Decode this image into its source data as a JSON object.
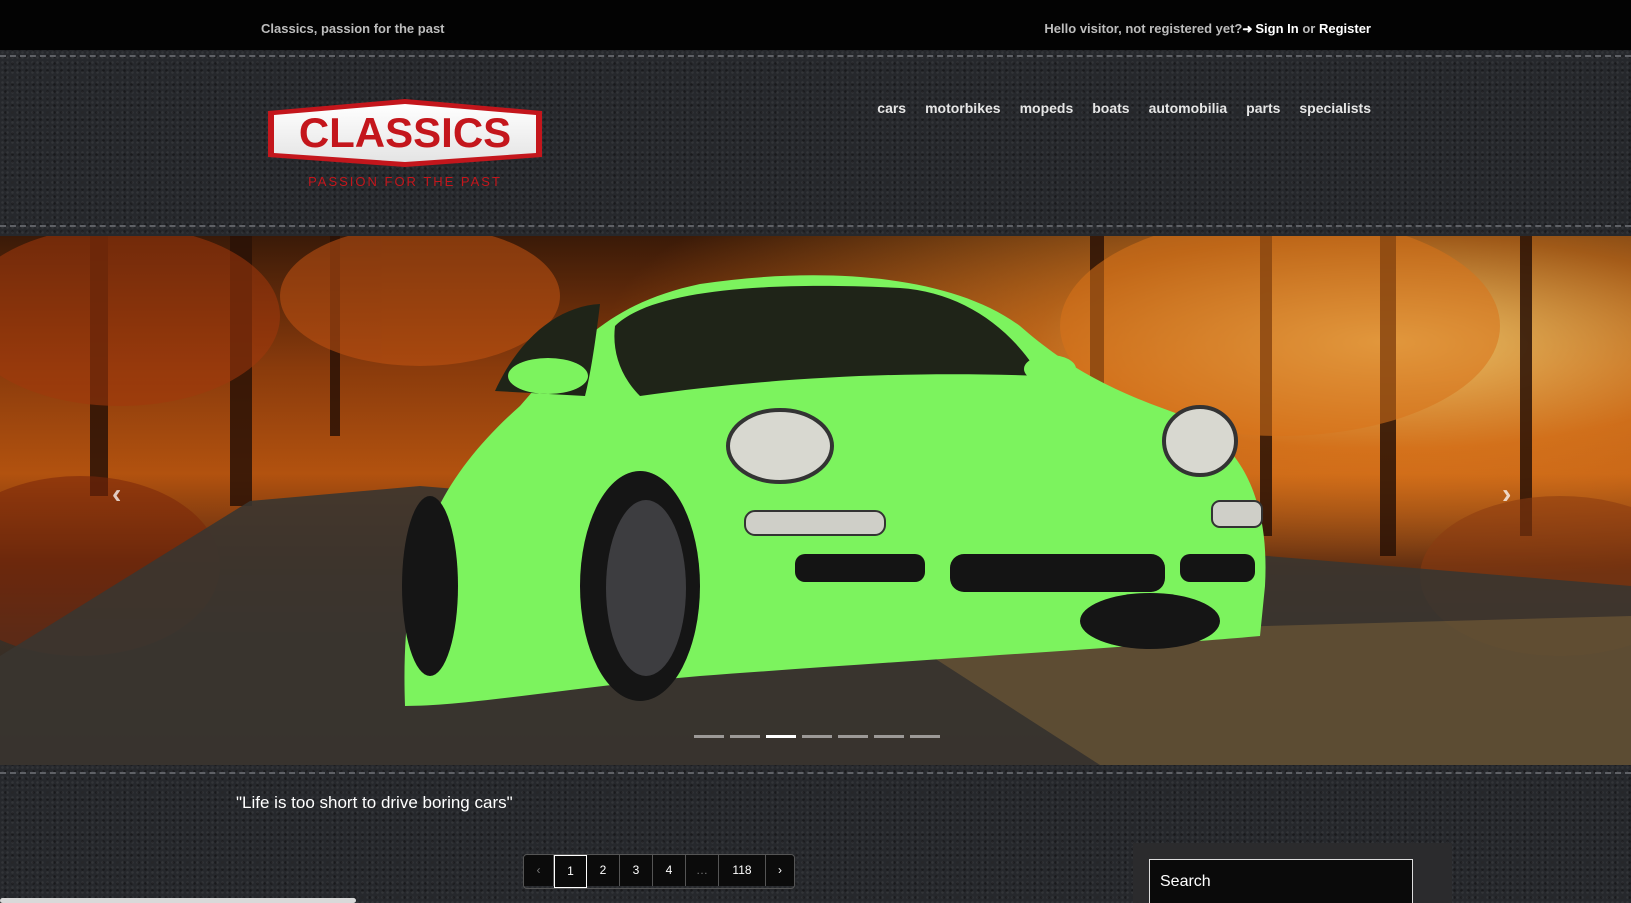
{
  "topbar": {
    "tagline": "Classics, passion for the past",
    "greeting": "Hello visitor, not registered yet?",
    "signin_label": "Sign In",
    "or_text": "or",
    "register_label": "Register"
  },
  "logo": {
    "title": "CLASSICS",
    "subtitle": "PASSION FOR THE PAST"
  },
  "nav": {
    "items": [
      {
        "label": "cars"
      },
      {
        "label": "motorbikes"
      },
      {
        "label": "mopeds"
      },
      {
        "label": "boats"
      },
      {
        "label": "automobilia"
      },
      {
        "label": "parts"
      },
      {
        "label": "specialists"
      }
    ]
  },
  "carousel": {
    "prev_glyph": "‹",
    "next_glyph": "›",
    "slide_count": 7,
    "active_index": 2
  },
  "quote": "\"Life is too short to drive boring cars\"",
  "pagination": {
    "prev": "‹",
    "pages": [
      "1",
      "2",
      "3",
      "4"
    ],
    "ellipsis": "…",
    "last": "118",
    "next": "›",
    "active": "1"
  },
  "search": {
    "placeholder": "Search"
  },
  "colors": {
    "accent_red": "#c4161c",
    "car_green": "#7cf35e"
  }
}
